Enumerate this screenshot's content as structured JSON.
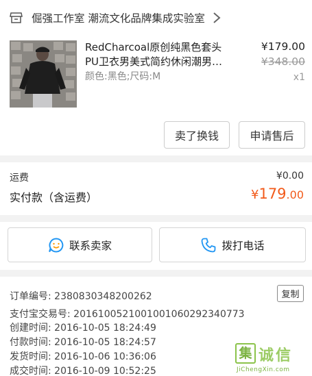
{
  "shop": {
    "name": "倔强工作室 潮流文化品牌集成实验室"
  },
  "item": {
    "title_line1": "RedCharcoal原创纯黑色套头",
    "title_line2": "PU卫衣男美式简约休闲潮男…",
    "sku": "颜色:黑色;尺码:M",
    "price": "¥179.00",
    "original_price": "¥348.00",
    "quantity": "x1",
    "sell_button": "卖了换钱",
    "after_sale_button": "申请售后"
  },
  "fees": {
    "shipping_label": "运费",
    "shipping_value": "¥0.00",
    "paid_label": "实付款（含运费）",
    "paid_currency": "¥",
    "paid_integer": "179",
    "paid_decimal": ".00"
  },
  "contact": {
    "seller_label": "联系卖家",
    "call_label": "拨打电话"
  },
  "order_info": {
    "order_number": "订单编号: 2380830348200262",
    "copy_label": "复制",
    "alipay_number": "支付宝交易号: 2016100521001001060292340773",
    "created": "创建时间: 2016-10-05 18:24:49",
    "paid": "付款时间: 2016-10-05 18:24:57",
    "shipped": "发货时间: 2016-10-06 10:36:06",
    "completed": "成交时间: 2016-10-09 10:52:25"
  },
  "watermark": {
    "mark": "集",
    "text": "诚信",
    "url": "JiChengXin.com"
  },
  "colors": {
    "accent_orange": "#f25a1a",
    "call_blue": "#2196f3",
    "watermark_green": "#8bc34a"
  }
}
